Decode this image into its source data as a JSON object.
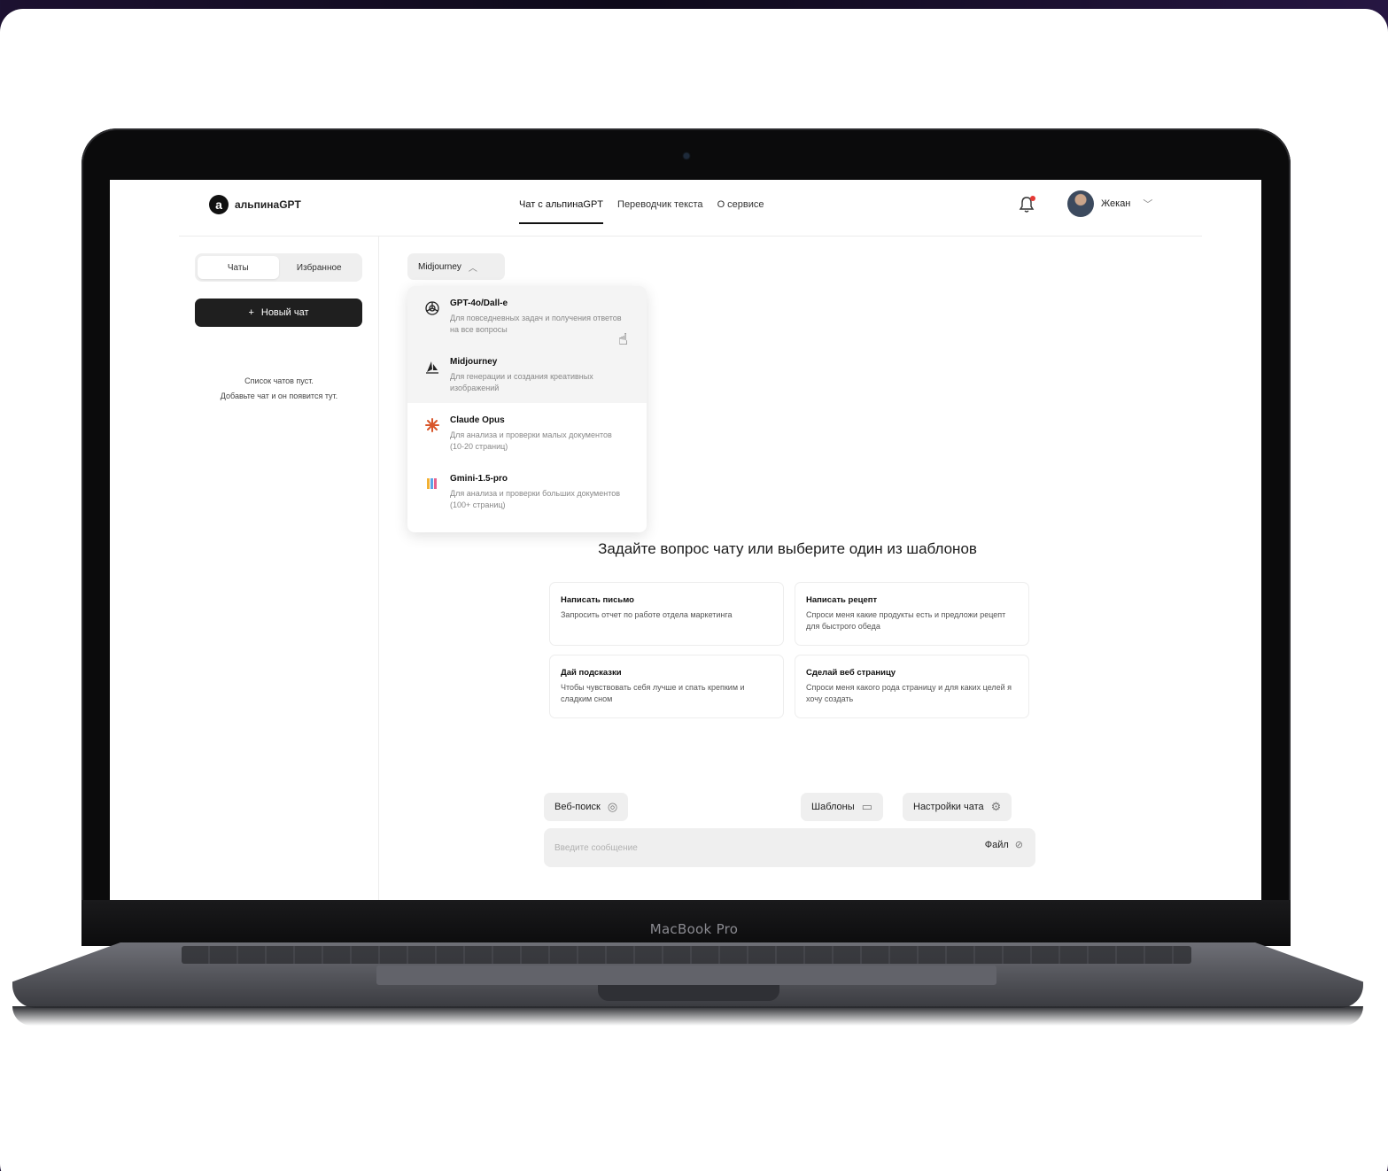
{
  "device": {
    "brand_label": "MacBook Pro"
  },
  "app": {
    "logo_letter": "а",
    "logo_text": "альпинаGPT",
    "nav": [
      {
        "label": "Чат с альпинаGPT",
        "active": true
      },
      {
        "label": "Переводчик текста",
        "active": false
      },
      {
        "label": "О сервисе",
        "active": false
      }
    ],
    "user_name": "Жекан"
  },
  "sidebar": {
    "tabs": [
      "Чаты",
      "Избранное"
    ],
    "new_chat_label": "Новый чат",
    "empty_line1": "Список чатов пуст.",
    "empty_line2": "Добавьте чат и он появится тут."
  },
  "model_select": {
    "value": "Midjourney",
    "options": [
      {
        "title": "GPT-4o/Dall-e",
        "desc": "Для повседневных задач и получения ответов на все вопросы",
        "icon": "openai-icon"
      },
      {
        "title": "Midjourney",
        "desc": "Для генерации и создания креативных изображений",
        "icon": "midjourney-icon"
      },
      {
        "title": "Claude Opus",
        "desc": "Для анализа и проверки малых документов (10-20 страниц)",
        "icon": "claude-icon"
      },
      {
        "title": "Gmini-1.5-pro",
        "desc": "Для анализа и проверки больших документов (100+ страниц)",
        "icon": "gemini-icon"
      }
    ]
  },
  "main": {
    "headline": "Задайте вопрос чату или выберите один из шаблонов",
    "templates": [
      {
        "title": "Написать письмо",
        "desc": "Запросить отчет по работе отдела маркетинга"
      },
      {
        "title": "Написать рецепт",
        "desc": "Спроси меня какие продукты есть и предложи рецепт для быстрого обеда"
      },
      {
        "title": "Дай подсказки",
        "desc": "Чтобы чувствовать себя лучше и спать крепким и сладким сном"
      },
      {
        "title": "Сделай веб страницу",
        "desc": "Спроси меня какого рода страницу и для каких целей я хочу создать"
      }
    ]
  },
  "composer": {
    "web_search_label": "Веб-поиск",
    "templates_label": "Шаблоны",
    "settings_label": "Настройки чата",
    "placeholder": "Введите сообщение",
    "file_label": "Файл"
  },
  "colors": {
    "accent": "#1f1f1f",
    "notification": "#e53935",
    "backdrop": "#1c1130"
  }
}
